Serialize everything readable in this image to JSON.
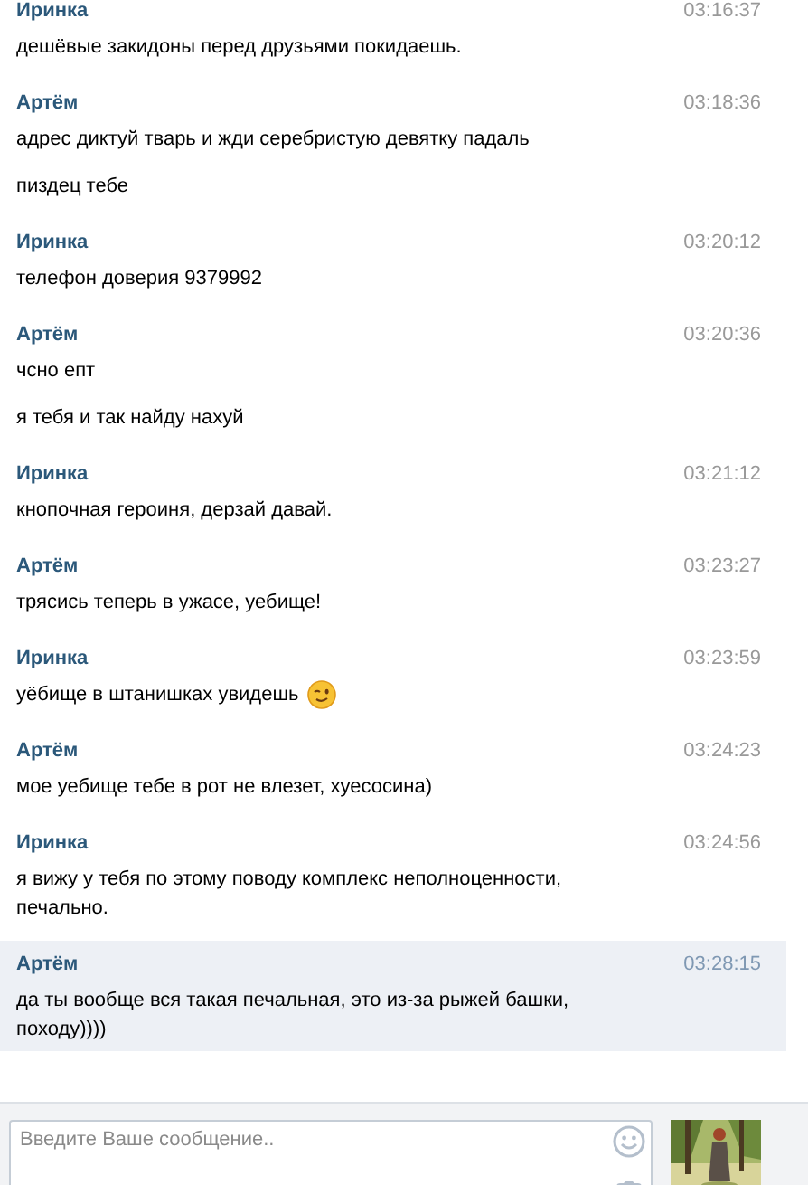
{
  "messages": [
    {
      "author": "Иринка",
      "time": "03:16:37",
      "lines": [
        "дешёвые закидоны перед друзьями покидаешь."
      ],
      "selected": false
    },
    {
      "author": "Артём",
      "time": "03:18:36",
      "lines": [
        "адрес диктуй тварь и жди серебристую девятку падаль",
        "пиздец тебе"
      ],
      "selected": false
    },
    {
      "author": "Иринка",
      "time": "03:20:12",
      "lines": [
        "телефон доверия 9379992"
      ],
      "selected": false
    },
    {
      "author": "Артём",
      "time": "03:20:36",
      "lines": [
        "чсно епт",
        "я тебя и так найду нахуй"
      ],
      "selected": false
    },
    {
      "author": "Иринка",
      "time": "03:21:12",
      "lines": [
        "кнопочная героиня, дерзай давай."
      ],
      "selected": false
    },
    {
      "author": "Артём",
      "time": "03:23:27",
      "lines": [
        "трясись теперь в ужасе, уебище!"
      ],
      "selected": false
    },
    {
      "author": "Иринка",
      "time": "03:23:59",
      "lines": [
        "уёбище в штанишках увидешь"
      ],
      "smiley": true,
      "selected": false
    },
    {
      "author": "Артём",
      "time": "03:24:23",
      "lines": [
        "мое уебище тебе в рот не влезет, хуесосина)"
      ],
      "selected": false
    },
    {
      "author": "Иринка",
      "time": "03:24:56",
      "lines": [
        "я вижу у тебя по этому поводу комплекс неполноценности, печально."
      ],
      "selected": false
    },
    {
      "author": "Артём",
      "time": "03:28:15",
      "lines": [
        "да ты вообще вся такая печальная, это из-за рыжей башки, походу))))"
      ],
      "selected": true
    }
  ],
  "composer": {
    "placeholder": "Введите Ваше сообщение.."
  }
}
